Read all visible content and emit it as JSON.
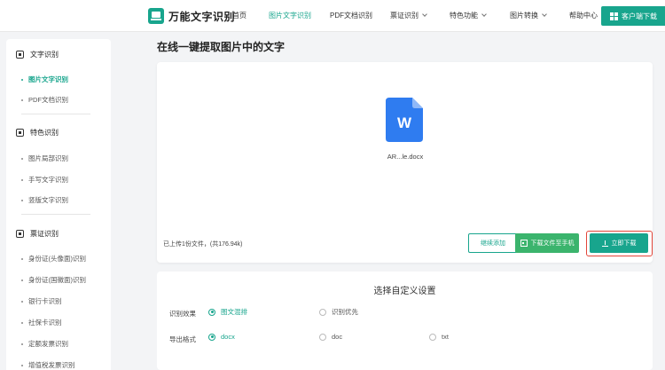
{
  "header": {
    "logo_text": "万能文字识别",
    "nav": [
      {
        "label": "首页"
      },
      {
        "label": "图片文字识别"
      },
      {
        "label": "PDF文档识别"
      },
      {
        "label": "票证识别"
      },
      {
        "label": "特色功能"
      },
      {
        "label": "图片转换"
      },
      {
        "label": "帮助中心"
      }
    ],
    "download_label": "客户端下载"
  },
  "sidebar": {
    "sections": [
      {
        "title": "文字识别",
        "items": [
          "图片文字识别",
          "PDF文档识别"
        ]
      },
      {
        "title": "特色识别",
        "items": [
          "图片局部识别",
          "手写文字识别",
          "竖版文字识别"
        ]
      },
      {
        "title": "票证识别",
        "items": [
          "身份证(头像面)识别",
          "身份证(国徽面)识别",
          "银行卡识别",
          "社保卡识别",
          "定额发票识别",
          "增值税发票识别"
        ]
      }
    ]
  },
  "main": {
    "title": "在线一键提取图片中的文字",
    "file_name": "AR...le.docx",
    "upload_info": "已上传1份文件，(共176.94k)",
    "continue_label": "继续添加",
    "phone_label": "下载文件至手机",
    "download_now_label": "立即下载"
  },
  "settings": {
    "title": "选择自定义设置",
    "effect_label": "识别效果",
    "effect_options": [
      "图文混排",
      "识别优先"
    ],
    "format_label": "导出格式",
    "format_options": [
      "docx",
      "doc",
      "txt"
    ]
  },
  "colors": {
    "accent": "#18a58d",
    "green": "#3bb46d",
    "highlight": "#e2463a",
    "word_blue": "#2f7cf0"
  }
}
